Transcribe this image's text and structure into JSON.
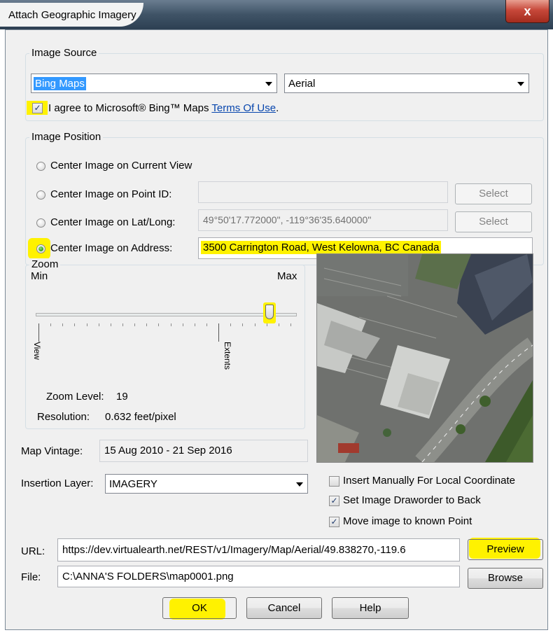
{
  "window": {
    "title": "Attach Geographic Imagery",
    "close_label": "x"
  },
  "image_source": {
    "legend": "Image Source",
    "provider": "Bing Maps",
    "map_type": "Aerial",
    "agree_text": "I agree to Microsoft® Bing™ Maps ",
    "terms_link": "Terms Of Use",
    "agree_suffix": ".",
    "agree_checked": true
  },
  "image_position": {
    "legend": "Image Position",
    "options": [
      {
        "label": "Center Image on Current View",
        "selected": false
      },
      {
        "label": "Center Image on Point ID:",
        "selected": false,
        "value": "",
        "button": "Select"
      },
      {
        "label": "Center Image on Lat/Long:",
        "selected": false,
        "value": "49°50'17.772000\", -119°36'35.640000\"",
        "button": "Select"
      },
      {
        "label": "Center Image on Address:",
        "selected": true,
        "value": "3500 Carrington Road, West Kelowna, BC Canada"
      }
    ]
  },
  "zoom": {
    "legend": "Zoom",
    "min_label": "Min",
    "max_label": "Max",
    "level_fraction": 0.9,
    "view_label": "View",
    "extents_label": "Extents",
    "zoom_level_label": "Zoom Level:",
    "zoom_level_value": "19",
    "resolution_label": "Resolution:",
    "resolution_value": "0.632 feet/pixel"
  },
  "map_vintage": {
    "label": "Map Vintage:",
    "value": "15 Aug 2010 - 21 Sep 2016"
  },
  "insertion_layer": {
    "label": "Insertion Layer:",
    "value": "IMAGERY"
  },
  "options": [
    {
      "label": "Insert Manually For Local Coordinate",
      "checked": false
    },
    {
      "label": "Set Image Draworder to Back",
      "checked": true
    },
    {
      "label": "Move image to known Point",
      "checked": true
    }
  ],
  "url": {
    "label": "URL:",
    "value": "https://dev.virtualearth.net/REST/v1/Imagery/Map/Aerial/49.838270,-119.6",
    "button": "Preview"
  },
  "file": {
    "label": "File:",
    "value": "C:\\ANNA'S FOLDERS\\map0001.png",
    "button": "Browse"
  },
  "buttons": {
    "ok": "OK",
    "cancel": "Cancel",
    "help": "Help"
  },
  "colors": {
    "highlight": "#fff200",
    "link": "#0645ad",
    "selection": "#3399ff"
  }
}
